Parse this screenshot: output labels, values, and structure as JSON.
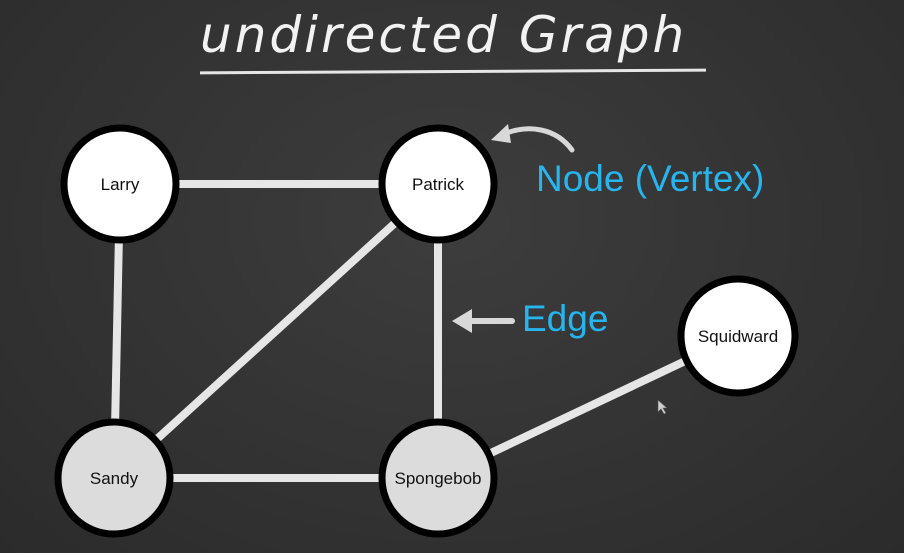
{
  "title": "undirected Graph",
  "annotations": {
    "node": "Node (Vertex)",
    "edge": "Edge"
  },
  "nodes": [
    {
      "id": "larry",
      "label": "Larry"
    },
    {
      "id": "patrick",
      "label": "Patrick"
    },
    {
      "id": "sandy",
      "label": "Sandy"
    },
    {
      "id": "spongebob",
      "label": "Spongebob"
    },
    {
      "id": "squidward",
      "label": "Squidward"
    }
  ],
  "edges": [
    {
      "from": "larry",
      "to": "patrick"
    },
    {
      "from": "larry",
      "to": "sandy"
    },
    {
      "from": "patrick",
      "to": "sandy"
    },
    {
      "from": "patrick",
      "to": "spongebob"
    },
    {
      "from": "sandy",
      "to": "spongebob"
    },
    {
      "from": "spongebob",
      "to": "squidward"
    }
  ],
  "colors": {
    "background": "#333333",
    "callout": "#26b5ef",
    "node_fill_light": "#ffffff",
    "node_fill_shaded": "#dcdcdc",
    "node_stroke": "#000000",
    "edge": "#e6e6e6"
  }
}
